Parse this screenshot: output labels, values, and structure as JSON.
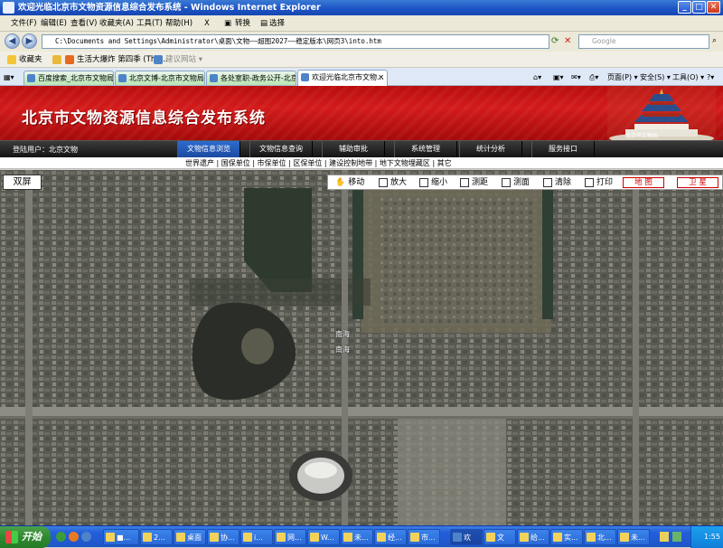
{
  "window": {
    "title": "欢迎光临北京市文物资源信息综合发布系统 - Windows Internet Explorer",
    "buttons": {
      "minimize": "_",
      "maximize": "□",
      "close": "✕"
    }
  },
  "menubar": {
    "items": [
      "文件(F)",
      "编辑(E)",
      "查看(V)",
      "收藏夹(A)",
      "工具(T)",
      "帮助(H)"
    ],
    "close_x": "X",
    "convert_label": "转换",
    "select_label": "选择"
  },
  "addressbar": {
    "url": "C:\\Documents and Settings\\Administrator\\桌面\\文物——超图2027——稳定版本\\网页3\\into.htm",
    "search_placeholder": "Google"
  },
  "favorites": {
    "label": "收藏夹",
    "items": [
      "生活大爆炸 第四季 (The...",
      "建议网站 ▾"
    ]
  },
  "tabs": {
    "items": [
      "百度搜索_北京市文物局",
      "北京文博-北京市文物局...",
      "各处室职-政务公开-北京...",
      "欢迎光临北京市文物..."
    ],
    "tools": [
      "页面(P) ▾",
      "安全(S) ▾",
      "工具(O) ▾"
    ]
  },
  "header": {
    "site_title": "北京市文物资源信息综合发布系统",
    "temple_caption": "北京市文物局"
  },
  "nav": {
    "login_user": "登陆用户：北京文物",
    "tabs": [
      "文物信息浏览",
      "文物信息查询",
      "辅助审批",
      "系统管理",
      "统计分析",
      "服务接口"
    ],
    "active_index": 0
  },
  "submenu": {
    "text": "世界遗产 | 国保单位 | 市保单位 | 区保单位 | 建设控制地带 | 地下文物埋藏区 | 其它"
  },
  "map": {
    "dual_screen": "双屏",
    "tools": [
      "移动",
      "放大",
      "缩小",
      "测距",
      "测面",
      "清除",
      "打印"
    ],
    "mode_map": "地 图",
    "mode_satellite": "卫 星",
    "labels": [
      "南海",
      "南海"
    ]
  },
  "taskbar": {
    "start": "开始",
    "items": [
      "■...",
      "2...",
      "桌面",
      "协...",
      "i...",
      "网...",
      "W...",
      "未...",
      "经...",
      "市...",
      "欢",
      "文",
      "给...",
      "实...",
      "北...",
      "未..."
    ],
    "time": "1:55"
  }
}
